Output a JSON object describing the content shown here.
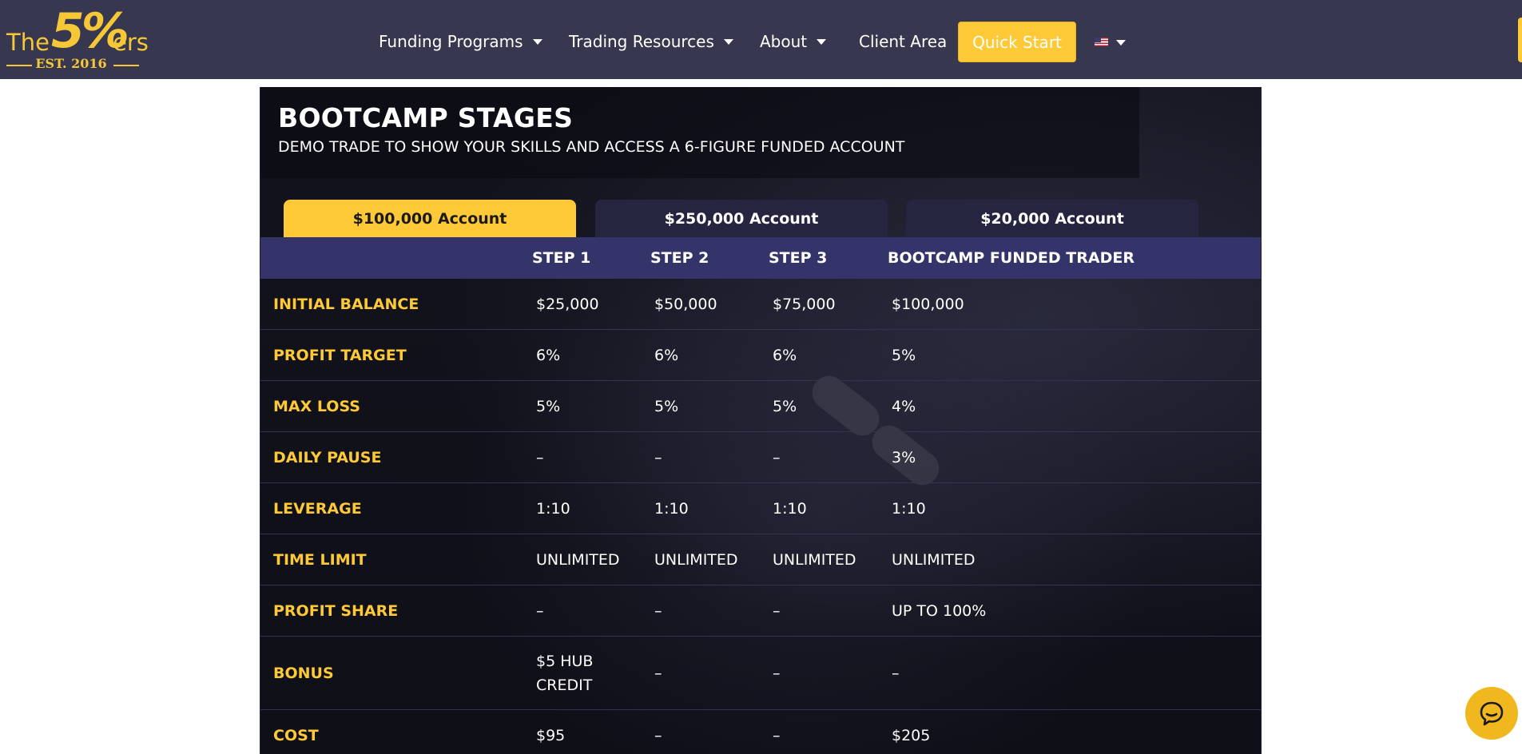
{
  "logo": {
    "the": "The",
    "five": "5%",
    "ers": "ers",
    "est": "EST. 2016"
  },
  "nav": {
    "items": [
      {
        "label": "Funding Programs",
        "has_dropdown": true
      },
      {
        "label": "Trading Resources",
        "has_dropdown": true
      },
      {
        "label": "About",
        "has_dropdown": true
      },
      {
        "label": "Client Area",
        "has_dropdown": false
      }
    ],
    "quick_start": "Quick Start",
    "language_icon": "us-flag-icon"
  },
  "section": {
    "title": "BOOTCAMP STAGES",
    "subtitle": "DEMO TRADE TO SHOW YOUR SKILLS AND ACCESS A 6-FIGURE FUNDED ACCOUNT"
  },
  "tabs": [
    {
      "label": "$100,000 Account",
      "active": true
    },
    {
      "label": "$250,000 Account",
      "active": false
    },
    {
      "label": "$20,000 Account",
      "active": false
    }
  ],
  "table": {
    "columns": [
      "",
      "STEP 1",
      "STEP 2",
      "STEP 3",
      "BOOTCAMP FUNDED TRADER"
    ],
    "rows": [
      {
        "label": "INITIAL BALANCE",
        "cells": [
          "$25,000",
          "$50,000",
          "$75,000",
          "$100,000"
        ]
      },
      {
        "label": "PROFIT TARGET",
        "cells": [
          "6%",
          "6%",
          "6%",
          "5%"
        ]
      },
      {
        "label": "MAX LOSS",
        "cells": [
          "5%",
          "5%",
          "5%",
          "4%"
        ]
      },
      {
        "label": "DAILY PAUSE",
        "cells": [
          "–",
          "–",
          "–",
          "3%"
        ]
      },
      {
        "label": "LEVERAGE",
        "cells": [
          "1:10",
          "1:10",
          "1:10",
          "1:10"
        ]
      },
      {
        "label": "TIME LIMIT",
        "cells": [
          "UNLIMITED",
          "UNLIMITED",
          "UNLIMITED",
          "UNLIMITED"
        ]
      },
      {
        "label": "PROFIT SHARE",
        "cells": [
          "–",
          "–",
          "–",
          "UP TO 100%"
        ]
      },
      {
        "label": "BONUS",
        "cells": [
          "$5 HUB CREDIT",
          "–",
          "–",
          "–"
        ]
      },
      {
        "label": "COST",
        "cells": [
          "$95",
          "–",
          "–",
          "$205"
        ]
      }
    ]
  },
  "colors": {
    "header_bg": "#37374f",
    "accent": "#fdc936",
    "table_head": "#34346a",
    "card_bg": "#13131d"
  },
  "chat_icon": "chat-bubble-icon"
}
